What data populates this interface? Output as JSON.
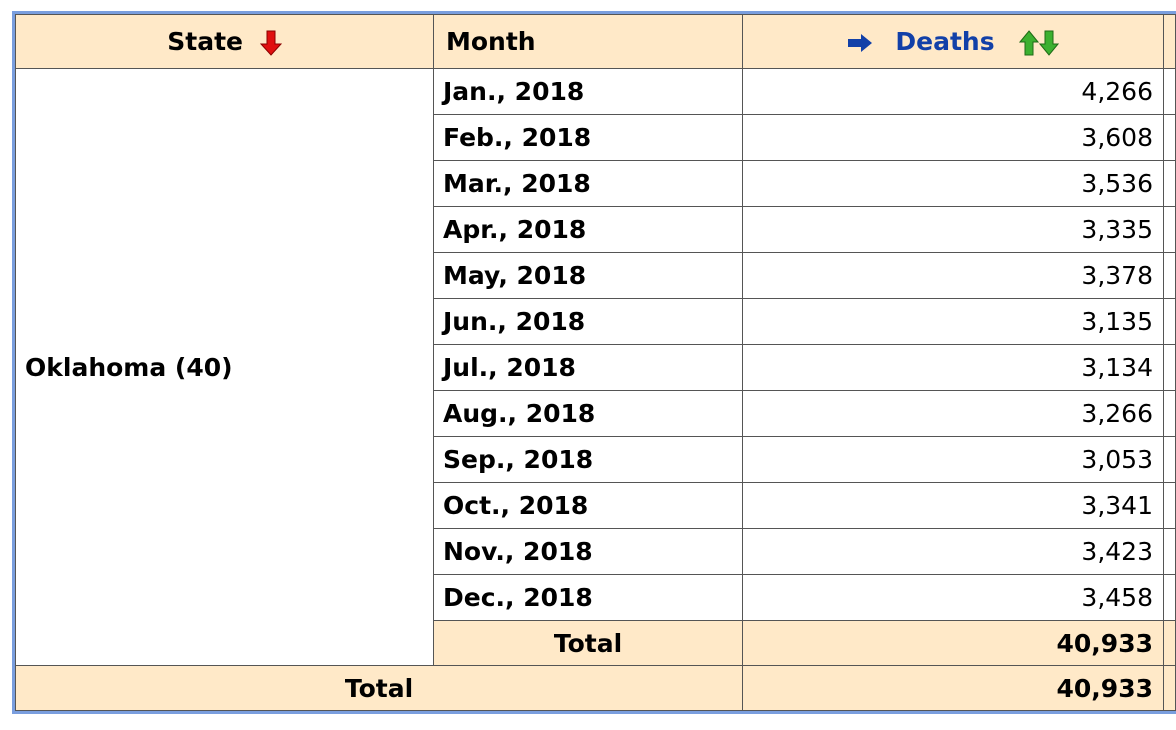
{
  "header": {
    "state_label": "State",
    "month_label": "Month",
    "deaths_label": "Deaths",
    "colors": {
      "header_bg": "#ffe9c8",
      "border": "#7a9ede",
      "sort_down_red": "#e01010",
      "sort_green": "#3cb030",
      "link_blue": "#1240a8"
    }
  },
  "group": {
    "state": "Oklahoma (40)",
    "rows": [
      {
        "month": "Jan., 2018",
        "deaths": "4,266"
      },
      {
        "month": "Feb., 2018",
        "deaths": "3,608"
      },
      {
        "month": "Mar., 2018",
        "deaths": "3,536"
      },
      {
        "month": "Apr., 2018",
        "deaths": "3,335"
      },
      {
        "month": "May, 2018",
        "deaths": "3,378"
      },
      {
        "month": "Jun., 2018",
        "deaths": "3,135"
      },
      {
        "month": "Jul., 2018",
        "deaths": "3,134"
      },
      {
        "month": "Aug., 2018",
        "deaths": "3,266"
      },
      {
        "month": "Sep., 2018",
        "deaths": "3,053"
      },
      {
        "month": "Oct., 2018",
        "deaths": "3,341"
      },
      {
        "month": "Nov., 2018",
        "deaths": "3,423"
      },
      {
        "month": "Dec., 2018",
        "deaths": "3,458"
      }
    ],
    "subtotal_label": "Total",
    "subtotal_value": "40,933"
  },
  "grand_total": {
    "label": "Total",
    "value": "40,933"
  }
}
